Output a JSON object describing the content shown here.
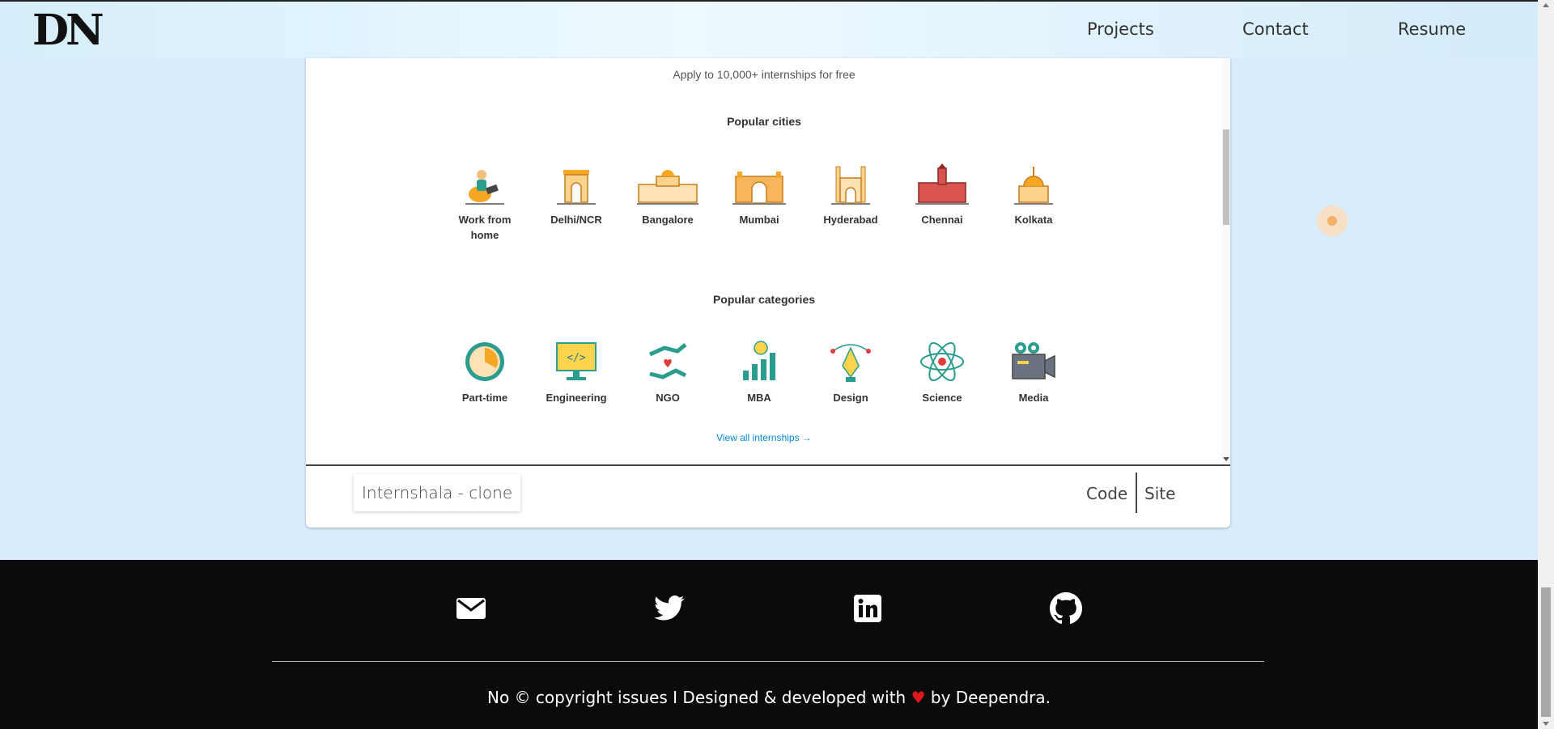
{
  "brand": {
    "logo": "DN"
  },
  "nav": {
    "projects": "Projects",
    "contact": "Contact",
    "resume": "Resume"
  },
  "preview": {
    "tagline": "Apply to 10,000+ internships for free",
    "cities_heading": "Popular cities",
    "cities": [
      "Work from home",
      "Delhi/NCR",
      "Bangalore",
      "Mumbai",
      "Hyderabad",
      "Chennai",
      "Kolkata"
    ],
    "categories_heading": "Popular categories",
    "categories": [
      "Part-time",
      "Engineering",
      "NGO",
      "MBA",
      "Design",
      "Science",
      "Media"
    ],
    "view_all": "View all internships",
    "view_all_arrow": "→"
  },
  "project": {
    "title": "Internshala - clone",
    "code": "Code",
    "site": "Site"
  },
  "footer": {
    "icons": [
      "mail-icon",
      "twitter-icon",
      "linkedin-icon",
      "github-icon"
    ],
    "copyright_pre": "No © copyright issues I Designed & developed with",
    "heart": "♥",
    "copyright_post": "by Deependra.",
    "heart_color": "#e0181b"
  },
  "colors": {
    "background": "#d9ecfd",
    "link": "#008bdc",
    "footer": "#0b0b0b"
  }
}
